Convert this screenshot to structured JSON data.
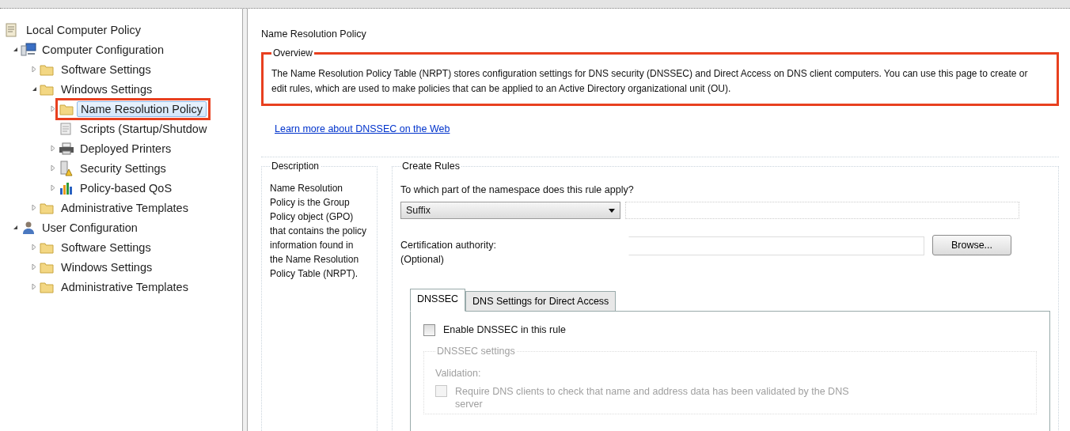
{
  "tree": [
    {
      "label": "Local Computer Policy",
      "kind": "policy",
      "selected": false,
      "children": [
        {
          "label": "Computer Configuration",
          "kind": "computer",
          "expanded": true,
          "selected": false,
          "children": [
            {
              "label": "Software Settings",
              "kind": "folder",
              "expanded": false,
              "selected": false
            },
            {
              "label": "Windows Settings",
              "kind": "folder",
              "expanded": true,
              "selected": false,
              "children": [
                {
                  "label": "Name Resolution Policy",
                  "kind": "folder",
                  "expanded": false,
                  "selected": true,
                  "highlighted": true
                },
                {
                  "label": "Scripts (Startup/Shutdow",
                  "kind": "scripts",
                  "selected": false
                },
                {
                  "label": "Deployed Printers",
                  "kind": "printer",
                  "expanded": false,
                  "selected": false
                },
                {
                  "label": "Security Settings",
                  "kind": "security",
                  "expanded": false,
                  "selected": false
                },
                {
                  "label": "Policy-based QoS",
                  "kind": "qos",
                  "expanded": false,
                  "selected": false
                }
              ]
            },
            {
              "label": "Administrative Templates",
              "kind": "folder",
              "expanded": false,
              "selected": false
            }
          ]
        },
        {
          "label": "User Configuration",
          "kind": "user",
          "expanded": true,
          "selected": false,
          "children": [
            {
              "label": "Software Settings",
              "kind": "folder",
              "expanded": false,
              "selected": false
            },
            {
              "label": "Windows Settings",
              "kind": "folder",
              "expanded": false,
              "selected": false
            },
            {
              "label": "Administrative Templates",
              "kind": "folder",
              "expanded": false,
              "selected": false
            }
          ]
        }
      ]
    }
  ],
  "page": {
    "title": "Name Resolution Policy",
    "overview": {
      "legend": "Overview",
      "highlighted": true,
      "text": "The Name Resolution Policy Table (NRPT) stores configuration settings for DNS security (DNSSEC) and Direct Access on DNS client computers. You can use this page to create or edit rules, which are used to make policies that can be applied to an Active Directory organizational unit (OU)."
    },
    "link": "Learn more about DNSSEC on the Web",
    "description": {
      "legend": "Description",
      "text": "Name Resolution Policy is the Group Policy object (GPO) that contains the policy information found in the Name Resolution Policy Table (NRPT)."
    },
    "create_rules": {
      "legend": "Create Rules",
      "question": "To which part of the namespace does this rule apply?",
      "dropdown": {
        "value": "Suffix"
      },
      "cert_label": "Certification authority:",
      "cert_optional": "(Optional)",
      "browse": "Browse...",
      "tabs": [
        {
          "label": "DNSSEC",
          "selected": true
        },
        {
          "label": "DNS Settings for Direct Access",
          "selected": false
        }
      ],
      "enable": {
        "label": "Enable DNSSEC in this rule",
        "checked": false
      },
      "settings": {
        "legend": "DNSSEC settings",
        "disabled": true,
        "validation": "Validation:",
        "require": {
          "label": "Require DNS clients to check that name and address data has been validated by the DNS server",
          "checked": false
        }
      }
    }
  }
}
